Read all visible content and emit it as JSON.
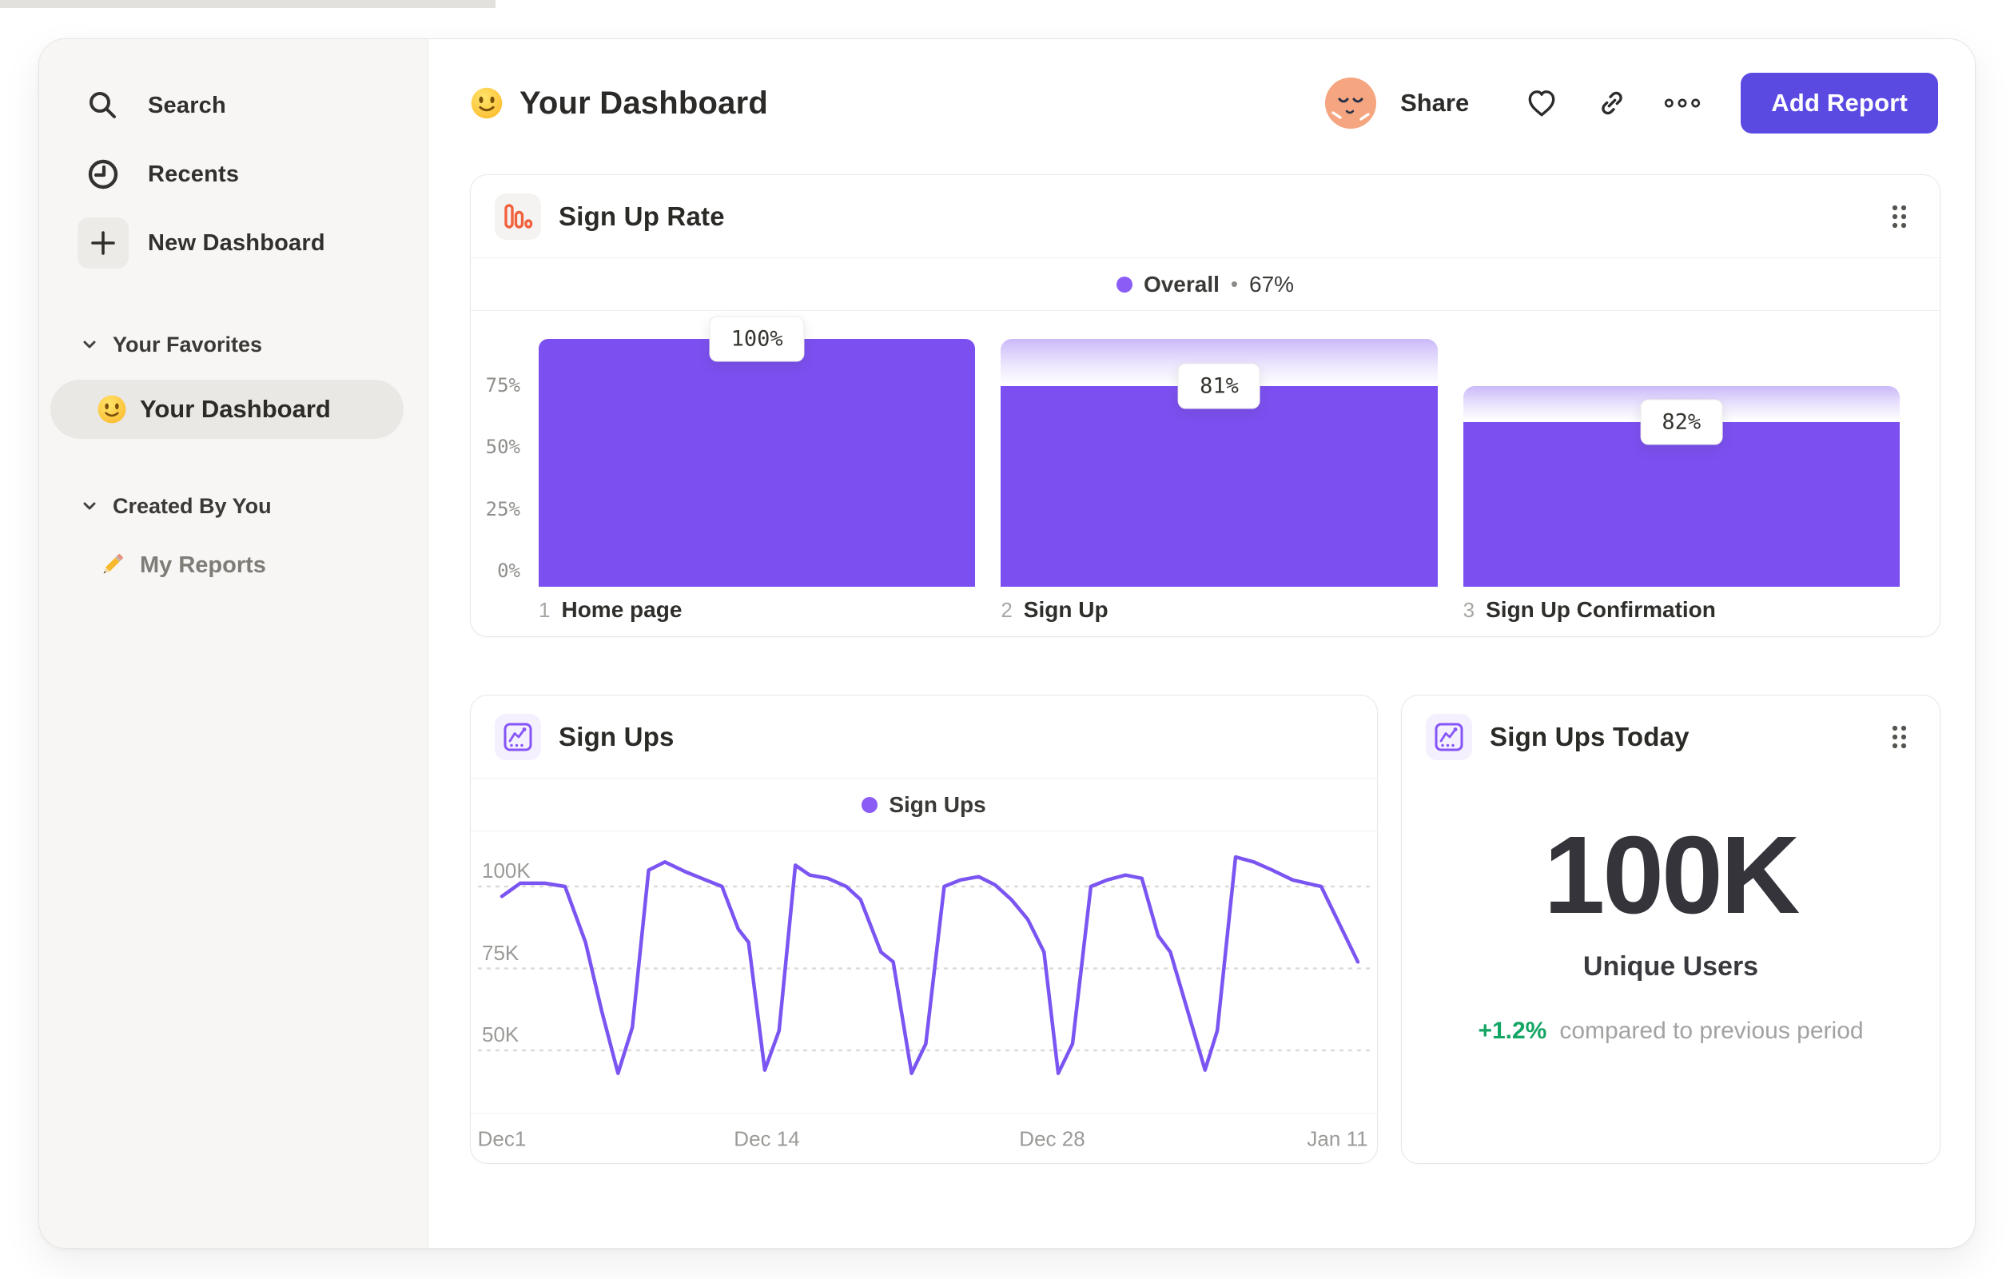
{
  "colors": {
    "bar_purple": "#7C50F0",
    "line_purple": "#7B55F2",
    "legend_purple": "#8B5CF6",
    "button_indigo": "#5A4AE2",
    "funnel_icon_orange": "#F0613E",
    "delta_green": "#13A564"
  },
  "sidebar": {
    "nav": [
      {
        "icon": "search-icon",
        "label": "Search"
      },
      {
        "icon": "clock-icon",
        "label": "Recents"
      },
      {
        "icon": "plus-icon",
        "label": "New Dashboard"
      }
    ],
    "sections": [
      {
        "title": "Your Favorites",
        "items": [
          {
            "icon": "smiley-emoji",
            "label": "Your Dashboard",
            "active": true
          }
        ]
      },
      {
        "title": "Created By You",
        "items": [
          {
            "icon": "pencil-emoji",
            "label": "My Reports",
            "active": false
          }
        ]
      }
    ]
  },
  "header": {
    "emoji": "smiley",
    "title": "Your Dashboard",
    "share_label": "Share",
    "add_report_label": "Add Report"
  },
  "cards": {
    "funnel": {
      "title": "Sign Up Rate",
      "legend_label": "Overall",
      "legend_separator": "•",
      "legend_value": "67%"
    },
    "line": {
      "title": "Sign Ups",
      "legend_label": "Sign Ups"
    },
    "metric": {
      "title": "Sign Ups Today",
      "value": "100K",
      "label": "Unique Users",
      "delta": "+1.2%",
      "delta_note": "compared to previous period"
    }
  },
  "chart_data": [
    {
      "type": "bar",
      "subtype": "funnel",
      "title": "Sign Up Rate",
      "legend": "Overall",
      "overall_conversion": "67%",
      "bar_color": "#7C50F0",
      "ylim": [
        0,
        100
      ],
      "y_ticks": [
        75,
        50,
        25,
        0
      ],
      "y_tick_suffix": "%",
      "steps": [
        {
          "index": "1",
          "name": "Home page",
          "label": "100%",
          "overall_pct": 100,
          "prev_pct": 100
        },
        {
          "index": "2",
          "name": "Sign Up",
          "label": "81%",
          "overall_pct": 81,
          "prev_pct": 100
        },
        {
          "index": "3",
          "name": "Sign Up Confirmation",
          "label": "82%",
          "overall_pct": 66.4,
          "prev_pct": 81
        }
      ]
    },
    {
      "type": "line",
      "title": "Sign Ups",
      "legend": "Sign Ups",
      "line_color": "#7B55F2",
      "unit": "K",
      "grid": "dashed-horizontal",
      "y_ticks": [
        {
          "v": 100,
          "label": "100K"
        },
        {
          "v": 75,
          "label": "75K"
        },
        {
          "v": 50,
          "label": "50K"
        }
      ],
      "x_ticks": [
        {
          "day": 0,
          "label": "Dec1"
        },
        {
          "day": 13,
          "label": "Dec 14"
        },
        {
          "day": 27,
          "label": "Dec 28"
        },
        {
          "day": 41,
          "label": "Jan 11"
        }
      ],
      "x_range_days": [
        0,
        42
      ],
      "y_range": [
        40,
        112
      ],
      "points": [
        [
          0,
          97
        ],
        [
          0.9,
          101
        ],
        [
          2.1,
          101
        ],
        [
          3.1,
          100
        ],
        [
          4.1,
          83
        ],
        [
          4.9,
          62
        ],
        [
          5.7,
          43
        ],
        [
          6.4,
          57
        ],
        [
          7.2,
          105
        ],
        [
          8,
          107.5
        ],
        [
          9,
          104.5
        ],
        [
          10,
          102
        ],
        [
          10.8,
          100
        ],
        [
          11.6,
          87
        ],
        [
          12.1,
          83
        ],
        [
          12.9,
          44
        ],
        [
          13.6,
          56
        ],
        [
          14.4,
          106.5
        ],
        [
          15.1,
          103.5
        ],
        [
          16,
          102.5
        ],
        [
          16.9,
          100
        ],
        [
          17.6,
          96
        ],
        [
          18.6,
          80
        ],
        [
          19.2,
          77
        ],
        [
          20.1,
          43
        ],
        [
          20.8,
          52
        ],
        [
          21.7,
          100
        ],
        [
          22.5,
          102
        ],
        [
          23.4,
          103
        ],
        [
          24.2,
          100.5
        ],
        [
          25,
          96
        ],
        [
          25.8,
          90
        ],
        [
          26.6,
          80
        ],
        [
          27.3,
          43
        ],
        [
          28,
          52
        ],
        [
          28.9,
          100
        ],
        [
          29.7,
          102
        ],
        [
          30.6,
          103.5
        ],
        [
          31.4,
          102.5
        ],
        [
          32.2,
          85
        ],
        [
          32.8,
          80
        ],
        [
          34.5,
          44
        ],
        [
          35.1,
          56
        ],
        [
          36,
          109
        ],
        [
          36.9,
          107.5
        ],
        [
          37.8,
          105
        ],
        [
          38.8,
          102
        ],
        [
          40.2,
          100
        ],
        [
          42,
          77
        ]
      ]
    }
  ]
}
